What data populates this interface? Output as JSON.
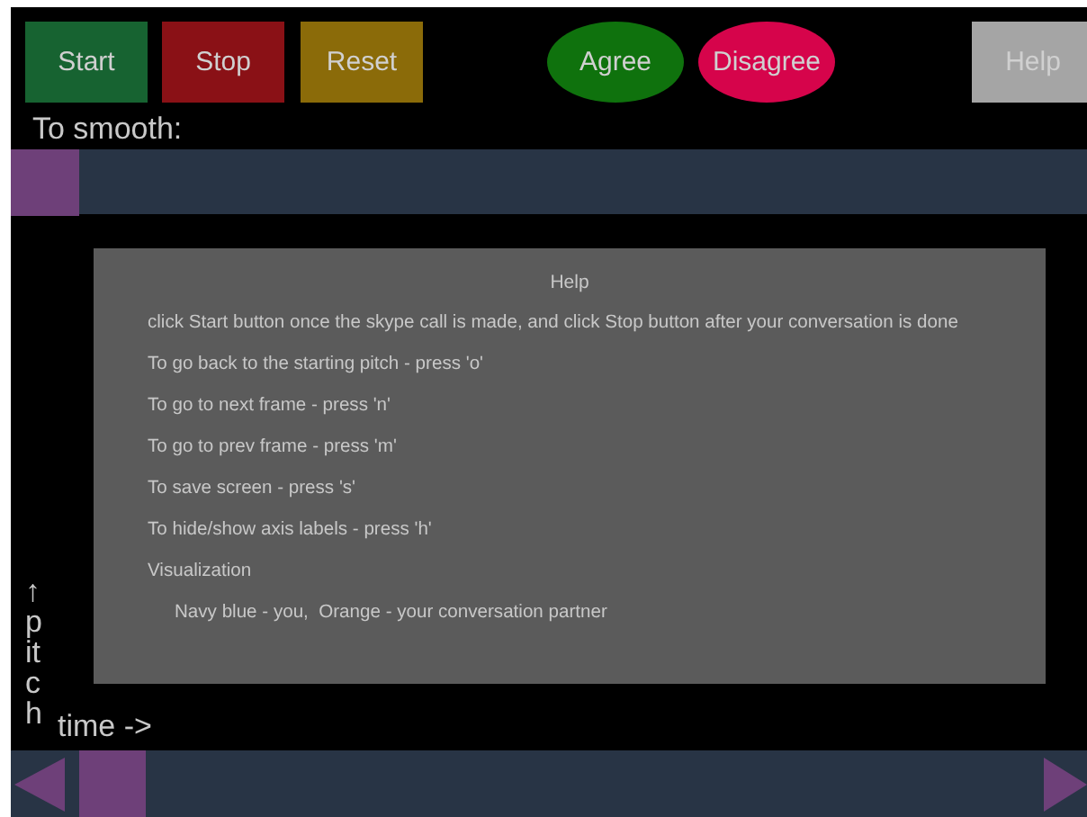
{
  "buttons": [
    {
      "label": "Start",
      "kind": "rect",
      "color": "#176331"
    },
    {
      "label": "Stop",
      "kind": "rect",
      "color": "#8a1116"
    },
    {
      "label": "Reset",
      "kind": "rect",
      "color": "#8b6b09"
    },
    {
      "label": "Agree",
      "kind": "oval",
      "color": "#0f720d"
    },
    {
      "label": "Disagree",
      "kind": "oval",
      "color": "#d6044b"
    },
    {
      "label": "Help",
      "kind": "rect",
      "color": "#a5a5a5"
    }
  ],
  "smooth": {
    "label": "To smooth:",
    "level": 0
  },
  "help": {
    "title": "Help",
    "lines": [
      {
        "text": "click Start button once the skype call is made, and click Stop button after your conversation is done",
        "indented": false
      },
      {
        "text": "To go back to the starting pitch - press 'o'",
        "indented": false
      },
      {
        "text": "To go to next frame - press 'n'",
        "indented": false
      },
      {
        "text": "To go to prev frame - press 'm'",
        "indented": false
      },
      {
        "text": "To save screen - press 's'",
        "indented": false
      },
      {
        "text": "To hide/show axis labels - press 'h'",
        "indented": false
      },
      {
        "text": "Visualization",
        "indented": false
      },
      {
        "text": "Navy blue - you,  Orange - your conversation partner",
        "indented": true
      }
    ]
  },
  "y_axis_label": "↑pitch",
  "x_axis_label": "time ->"
}
